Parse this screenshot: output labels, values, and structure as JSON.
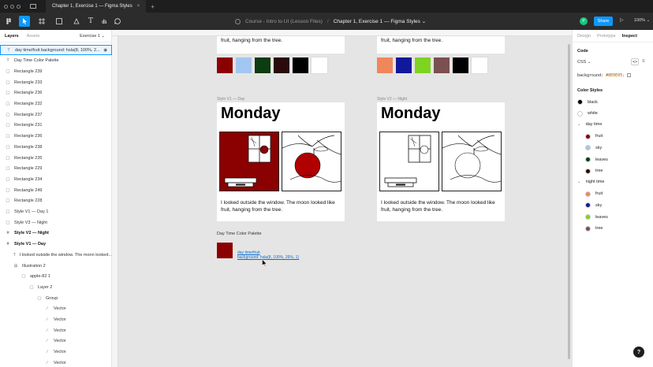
{
  "titlebar": {
    "tabs": [
      {
        "label": "Chapter 1, Exercise 1 — Figma Styles",
        "close": "×"
      }
    ],
    "new_tab": "+"
  },
  "toolbar": {
    "file_path": {
      "project": "Course - Intro to UI (Lesson Files)",
      "separator": "/",
      "file": "Chapter 1, Exercise 1 — Figma Styles ⌄"
    },
    "avatar_initial": "P",
    "share_label": "Share",
    "zoom_label": "100% ⌄"
  },
  "left_panel": {
    "tabs": {
      "layers": "Layers",
      "assets": "Assets",
      "page": "Exercise 1 ⌄"
    },
    "layers": [
      {
        "label": "day time/fruit background: hsla(8, 100%, 2...",
        "icon": "T",
        "indent": 0,
        "selected": true,
        "bold": false
      },
      {
        "label": "Day Time Color Palette",
        "icon": "T",
        "indent": 0
      },
      {
        "label": "Rectangle 239",
        "icon": "▢",
        "indent": 0
      },
      {
        "label": "Rectangle 233",
        "icon": "▢",
        "indent": 0
      },
      {
        "label": "Rectangle 236",
        "icon": "▢",
        "indent": 0
      },
      {
        "label": "Rectangle 232",
        "icon": "▢",
        "indent": 0
      },
      {
        "label": "Rectangle 237",
        "icon": "▢",
        "indent": 0
      },
      {
        "label": "Rectangle 231",
        "icon": "▢",
        "indent": 0
      },
      {
        "label": "Rectangle 236",
        "icon": "▢",
        "indent": 0
      },
      {
        "label": "Rectangle 238",
        "icon": "▢",
        "indent": 0
      },
      {
        "label": "Rectangle 235",
        "icon": "▢",
        "indent": 0
      },
      {
        "label": "Rectangle 229",
        "icon": "▢",
        "indent": 0
      },
      {
        "label": "Rectangle 234",
        "icon": "▢",
        "indent": 0
      },
      {
        "label": "Rectangle 249",
        "icon": "▢",
        "indent": 0
      },
      {
        "label": "Rectangle 228",
        "icon": "▢",
        "indent": 0
      },
      {
        "label": "Style V1 — Day 1",
        "icon": "▢",
        "indent": 0
      },
      {
        "label": "Style V3 — Night",
        "icon": "▢",
        "indent": 0
      },
      {
        "label": "Style V2 — Night",
        "icon": "#",
        "indent": 0,
        "bold": true
      },
      {
        "label": "Style V1 — Day",
        "icon": "#",
        "indent": 0,
        "bold": true
      },
      {
        "label": "I looked outside the window. The moon looked...",
        "icon": "T",
        "indent": 1
      },
      {
        "label": "Illustration 2",
        "icon": "⊞",
        "indent": 1
      },
      {
        "label": "apple-82 1",
        "icon": "▢",
        "indent": 2
      },
      {
        "label": "Layer 2",
        "icon": "▢",
        "indent": 3
      },
      {
        "label": "Group",
        "icon": "▢",
        "indent": 4
      },
      {
        "label": "Vector",
        "icon": "∕",
        "indent": 5
      },
      {
        "label": "Vector",
        "icon": "∕",
        "indent": 5
      },
      {
        "label": "Vector",
        "icon": "∕",
        "indent": 5
      },
      {
        "label": "Vector",
        "icon": "∕",
        "indent": 5
      },
      {
        "label": "Vector",
        "icon": "∕",
        "indent": 5
      },
      {
        "label": "Vector",
        "icon": "∕",
        "indent": 5
      }
    ]
  },
  "canvas": {
    "top_text_fragment": "fruit, hanging from the tree.",
    "day_palette_colors": [
      "#8b0000",
      "#a3c6f0",
      "#0d3b12",
      "#2a0a0a",
      "#000000",
      "#ffffff"
    ],
    "night_palette_colors": [
      "#f0875a",
      "#12189c",
      "#7ed321",
      "#7a5050",
      "#000000",
      "#ffffff"
    ],
    "frames": {
      "day": {
        "label": "Style V1 — Day",
        "title": "Monday",
        "caption": "I looked outside the window. The moon looked like fruit, hanging from the tree."
      },
      "night": {
        "label": "Style V2 — Night",
        "title": "Monday",
        "caption": "I looked outside the window. The moon looked like fruit, hanging from the tree."
      }
    },
    "palette_label": "Day Time Color Palette",
    "fruit_swatch_color": "#8b0000",
    "fruit_style_name": "day time/fruit",
    "fruit_style_value": "background: hsla(8, 100%, 26%, 1)"
  },
  "right_panel": {
    "tabs": {
      "design": "Design",
      "prototype": "Prototype",
      "inspect": "Inspect"
    },
    "code_label": "Code",
    "css_label": "CSS ⌄",
    "code_line": {
      "prop": "background:",
      "value": "#8E0E05;"
    },
    "color_styles_label": "Color Styles",
    "styles": [
      {
        "type": "color",
        "name": "black",
        "color": "#000000"
      },
      {
        "type": "color",
        "name": "white",
        "color": "#ffffff"
      },
      {
        "type": "group",
        "name": "day time"
      },
      {
        "type": "color",
        "name": "fruit",
        "color": "#8b0000"
      },
      {
        "type": "color",
        "name": "sky",
        "color": "#a3c6f0"
      },
      {
        "type": "color",
        "name": "leaves",
        "color": "#0d3b12"
      },
      {
        "type": "color",
        "name": "tree",
        "color": "#2a0a0a"
      },
      {
        "type": "group",
        "name": "night time"
      },
      {
        "type": "color",
        "name": "fruit",
        "color": "#f0875a"
      },
      {
        "type": "color",
        "name": "sky",
        "color": "#12189c"
      },
      {
        "type": "color",
        "name": "leaves",
        "color": "#7ed321"
      },
      {
        "type": "color",
        "name": "tree",
        "color": "#7a5050"
      }
    ],
    "help_label": "?"
  }
}
